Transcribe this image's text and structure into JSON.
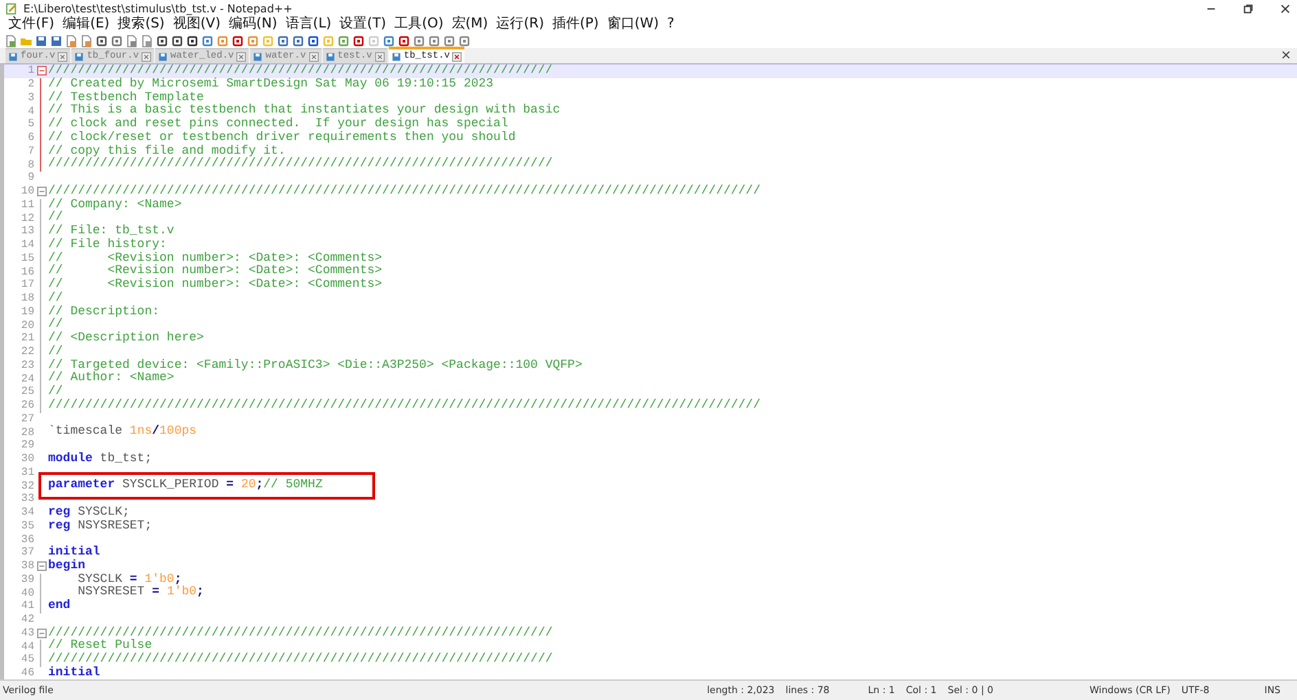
{
  "window": {
    "title": "E:\\Libero\\test\\test\\stimulus\\tb_tst.v - Notepad++"
  },
  "menu": [
    "文件(F)",
    "编辑(E)",
    "搜索(S)",
    "视图(V)",
    "编码(N)",
    "语言(L)",
    "设置(T)",
    "工具(O)",
    "宏(M)",
    "运行(R)",
    "插件(P)",
    "窗口(W)",
    "?"
  ],
  "tabs": [
    {
      "label": "four.v",
      "selected": false
    },
    {
      "label": "tb_four.v",
      "selected": false
    },
    {
      "label": "water_led.v",
      "selected": false
    },
    {
      "label": "water.v",
      "selected": false
    },
    {
      "label": "test.v",
      "selected": false
    },
    {
      "label": "tb_tst.v",
      "selected": true
    }
  ],
  "editor": {
    "lines": [
      {
        "num": "1",
        "fold_start": true,
        "fold_body": false,
        "current": true,
        "boxed": false,
        "tokens": [
          {
            "kind": "comment",
            "text": "////////////////////////////////////////////////////////////////////"
          }
        ]
      },
      {
        "num": "2",
        "fold_start": false,
        "fold_body": true,
        "current": false,
        "boxed": false,
        "tokens": [
          {
            "kind": "comment",
            "text": "// Created by Microsemi SmartDesign Sat May 06 19:10:15 2023"
          }
        ]
      },
      {
        "num": "3",
        "fold_start": false,
        "fold_body": true,
        "current": false,
        "boxed": false,
        "tokens": [
          {
            "kind": "comment",
            "text": "// Testbench Template"
          }
        ]
      },
      {
        "num": "4",
        "fold_start": false,
        "fold_body": true,
        "current": false,
        "boxed": false,
        "tokens": [
          {
            "kind": "comment",
            "text": "// This is a basic testbench that instantiates your design with basic"
          }
        ]
      },
      {
        "num": "5",
        "fold_start": false,
        "fold_body": true,
        "current": false,
        "boxed": false,
        "tokens": [
          {
            "kind": "comment",
            "text": "// clock and reset pins connected.  If your design has special"
          }
        ]
      },
      {
        "num": "6",
        "fold_start": false,
        "fold_body": true,
        "current": false,
        "boxed": false,
        "tokens": [
          {
            "kind": "comment",
            "text": "// clock/reset or testbench driver requirements then you should"
          }
        ]
      },
      {
        "num": "7",
        "fold_start": false,
        "fold_body": true,
        "current": false,
        "boxed": false,
        "tokens": [
          {
            "kind": "comment",
            "text": "// copy this file and modify it."
          }
        ]
      },
      {
        "num": "8",
        "fold_start": false,
        "fold_body": true,
        "current": false,
        "boxed": false,
        "tokens": [
          {
            "kind": "comment",
            "text": "////////////////////////////////////////////////////////////////////"
          }
        ]
      },
      {
        "num": "9",
        "fold_start": false,
        "fold_body": false,
        "current": false
      },
      {
        "num": "10",
        "fold_start": true,
        "fold_body": false,
        "current": false,
        "boxed": false,
        "tokens": [
          {
            "kind": "comment",
            "text": "////////////////////////////////////////////////////////////////////////////////////////////////"
          }
        ]
      },
      {
        "num": "11",
        "fold_start": false,
        "fold_body": true,
        "current": false,
        "boxed": false,
        "tokens": [
          {
            "kind": "comment",
            "text": "// Company: <Name>"
          }
        ]
      },
      {
        "num": "12",
        "fold_start": false,
        "fold_body": true,
        "current": false,
        "boxed": false,
        "tokens": [
          {
            "kind": "comment",
            "text": "//"
          }
        ]
      },
      {
        "num": "13",
        "fold_start": false,
        "fold_body": true,
        "current": false,
        "boxed": false,
        "tokens": [
          {
            "kind": "comment",
            "text": "// File: tb_tst.v"
          }
        ]
      },
      {
        "num": "14",
        "fold_start": false,
        "fold_body": true,
        "current": false,
        "boxed": false,
        "tokens": [
          {
            "kind": "comment",
            "text": "// File history:"
          }
        ]
      },
      {
        "num": "15",
        "fold_start": false,
        "fold_body": true,
        "current": false,
        "boxed": false,
        "tokens": [
          {
            "kind": "comment",
            "text": "//      <Revision number>: <Date>: <Comments>"
          }
        ]
      },
      {
        "num": "16",
        "fold_start": false,
        "fold_body": true,
        "current": false,
        "boxed": false,
        "tokens": [
          {
            "kind": "comment",
            "text": "//      <Revision number>: <Date>: <Comments>"
          }
        ]
      },
      {
        "num": "17",
        "fold_start": false,
        "fold_body": true,
        "current": false,
        "boxed": false,
        "tokens": [
          {
            "kind": "comment",
            "text": "//      <Revision number>: <Date>: <Comments>"
          }
        ]
      },
      {
        "num": "18",
        "fold_start": false,
        "fold_body": true,
        "current": false,
        "boxed": false,
        "tokens": [
          {
            "kind": "comment",
            "text": "//"
          }
        ]
      },
      {
        "num": "19",
        "fold_start": false,
        "fold_body": true,
        "current": false,
        "boxed": false,
        "tokens": [
          {
            "kind": "comment",
            "text": "// Description:"
          }
        ]
      },
      {
        "num": "20",
        "fold_start": false,
        "fold_body": true,
        "current": false,
        "boxed": false,
        "tokens": [
          {
            "kind": "comment",
            "text": "//"
          }
        ]
      },
      {
        "num": "21",
        "fold_start": false,
        "fold_body": true,
        "current": false,
        "boxed": false,
        "tokens": [
          {
            "kind": "comment",
            "text": "// <Description here>"
          }
        ]
      },
      {
        "num": "22",
        "fold_start": false,
        "fold_body": true,
        "current": false,
        "boxed": false,
        "tokens": [
          {
            "kind": "comment",
            "text": "//"
          }
        ]
      },
      {
        "num": "23",
        "fold_start": false,
        "fold_body": true,
        "current": false,
        "boxed": false,
        "tokens": [
          {
            "kind": "comment",
            "text": "// Targeted device: <Family::ProASIC3> <Die::A3P250> <Package::100 VQFP>"
          }
        ]
      },
      {
        "num": "24",
        "fold_start": false,
        "fold_body": true,
        "current": false,
        "boxed": false,
        "tokens": [
          {
            "kind": "comment",
            "text": "// Author: <Name>"
          }
        ]
      },
      {
        "num": "25",
        "fold_start": false,
        "fold_body": true,
        "current": false,
        "boxed": false,
        "tokens": [
          {
            "kind": "comment",
            "text": "//"
          }
        ]
      },
      {
        "num": "26",
        "fold_start": false,
        "fold_body": true,
        "current": false,
        "boxed": false,
        "tokens": [
          {
            "kind": "comment",
            "text": "////////////////////////////////////////////////////////////////////////////////////////////////"
          }
        ]
      },
      {
        "num": "27",
        "fold_start": false,
        "fold_body": false,
        "current": false
      },
      {
        "num": "28",
        "fold_start": false,
        "fold_body": false,
        "current": false,
        "boxed": false,
        "tokens": [
          {
            "kind": "plain",
            "text": "`timescale "
          },
          {
            "kind": "number",
            "text": "1ns"
          },
          {
            "kind": "operator",
            "text": "/"
          },
          {
            "kind": "number",
            "text": "100ps"
          }
        ]
      },
      {
        "num": "29",
        "fold_start": false,
        "fold_body": false,
        "current": false
      },
      {
        "num": "30",
        "fold_start": false,
        "fold_body": false,
        "current": false,
        "boxed": false,
        "tokens": [
          {
            "kind": "keyword",
            "text": "module"
          },
          {
            "kind": "plain",
            "text": " tb_tst;"
          }
        ]
      },
      {
        "num": "31",
        "fold_start": false,
        "fold_body": false,
        "current": false
      },
      {
        "num": "32",
        "fold_start": false,
        "fold_body": false,
        "current": false,
        "boxed": true,
        "tokens": [
          {
            "kind": "keyword",
            "text": "parameter"
          },
          {
            "kind": "plain",
            "text": " SYSCLK_PERIOD "
          },
          {
            "kind": "operator",
            "text": "= "
          },
          {
            "kind": "number",
            "text": "20"
          },
          {
            "kind": "operator",
            "text": ";"
          },
          {
            "kind": "comment",
            "text": "// 50MHZ"
          }
        ]
      },
      {
        "num": "33",
        "fold_start": false,
        "fold_body": false,
        "current": false
      },
      {
        "num": "34",
        "fold_start": false,
        "fold_body": false,
        "current": false,
        "boxed": false,
        "tokens": [
          {
            "kind": "keyword",
            "text": "reg"
          },
          {
            "kind": "plain",
            "text": " SYSCLK;"
          }
        ]
      },
      {
        "num": "35",
        "fold_start": false,
        "fold_body": false,
        "current": false,
        "boxed": false,
        "tokens": [
          {
            "kind": "keyword",
            "text": "reg"
          },
          {
            "kind": "plain",
            "text": " NSYSRESET;"
          }
        ]
      },
      {
        "num": "36",
        "fold_start": false,
        "fold_body": false,
        "current": false
      },
      {
        "num": "37",
        "fold_start": false,
        "fold_body": false,
        "current": false,
        "boxed": false,
        "tokens": [
          {
            "kind": "keyword",
            "text": "initial"
          }
        ]
      },
      {
        "num": "38",
        "fold_start": true,
        "fold_body": false,
        "current": false,
        "boxed": false,
        "tokens": [
          {
            "kind": "keyword",
            "text": "begin"
          }
        ]
      },
      {
        "num": "39",
        "fold_start": false,
        "fold_body": true,
        "current": false,
        "boxed": false,
        "tokens": [
          {
            "kind": "plain",
            "text": "    SYSCLK "
          },
          {
            "kind": "operator",
            "text": "= "
          },
          {
            "kind": "number",
            "text": "1'b0"
          },
          {
            "kind": "operator",
            "text": ";"
          }
        ]
      },
      {
        "num": "40",
        "fold_start": false,
        "fold_body": true,
        "current": false,
        "boxed": false,
        "tokens": [
          {
            "kind": "plain",
            "text": "    NSYSRESET "
          },
          {
            "kind": "operator",
            "text": "= "
          },
          {
            "kind": "number",
            "text": "1'b0"
          },
          {
            "kind": "operator",
            "text": ";"
          }
        ]
      },
      {
        "num": "41",
        "fold_start": false,
        "fold_body": true,
        "current": false,
        "boxed": false,
        "tokens": [
          {
            "kind": "keyword",
            "text": "end"
          }
        ]
      },
      {
        "num": "42",
        "fold_start": false,
        "fold_body": false,
        "current": false
      },
      {
        "num": "43",
        "fold_start": true,
        "fold_body": false,
        "current": false,
        "boxed": false,
        "tokens": [
          {
            "kind": "comment",
            "text": "////////////////////////////////////////////////////////////////////"
          }
        ]
      },
      {
        "num": "44",
        "fold_start": false,
        "fold_body": true,
        "current": false,
        "boxed": false,
        "tokens": [
          {
            "kind": "comment",
            "text": "// Reset Pulse"
          }
        ]
      },
      {
        "num": "45",
        "fold_start": false,
        "fold_body": true,
        "current": false,
        "boxed": false,
        "tokens": [
          {
            "kind": "comment",
            "text": "////////////////////////////////////////////////////////////////////"
          }
        ]
      },
      {
        "num": "46",
        "fold_start": false,
        "fold_body": false,
        "current": false,
        "boxed": false,
        "tokens": [
          {
            "kind": "keyword",
            "text": "initial"
          }
        ]
      }
    ]
  },
  "status_bar": {
    "file_type": "Verilog file",
    "length": "length : 2,023",
    "lines": "lines : 78",
    "ln": "Ln : 1",
    "col": "Col : 1",
    "sel": "Sel : 0 | 0",
    "eol": "Windows (CR LF)",
    "encoding": "UTF-8",
    "mode": "INS"
  }
}
